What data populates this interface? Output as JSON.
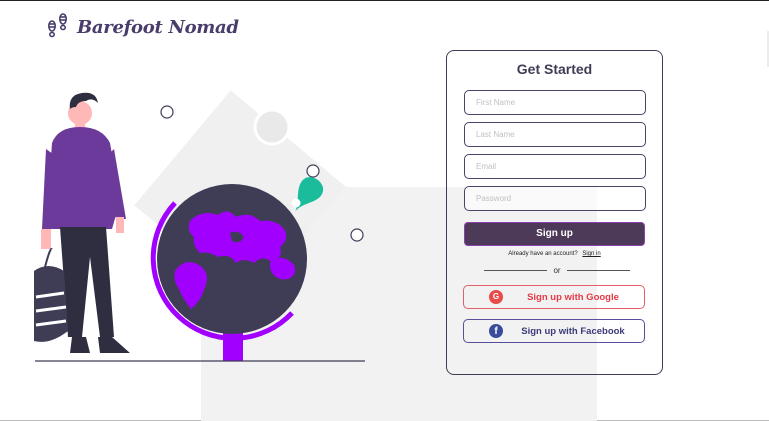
{
  "brand": {
    "name": "Barefoot Nomad"
  },
  "signup_card": {
    "title": "Get Started",
    "fields": {
      "first_name": {
        "placeholder": "First Name",
        "value": ""
      },
      "last_name": {
        "placeholder": "Last Name",
        "value": ""
      },
      "email": {
        "placeholder": "Email",
        "value": ""
      },
      "password": {
        "placeholder": "Password",
        "value": ""
      }
    },
    "signup_label": "Sign up",
    "have_account_text": "Already have an account?",
    "signin_link": "Sign in",
    "or_text": "or",
    "google_label": "Sign up with Google",
    "google_icon_letter": "G",
    "facebook_label": "Sign up with Facebook",
    "facebook_icon_letter": "f"
  },
  "colors": {
    "brand_purple": "#4a3d6b",
    "accent_purple": "#a100ff",
    "marker_green": "#1abc9c",
    "google_red": "#e53945",
    "facebook_blue": "#3b3a7a"
  },
  "icons": [
    "footprints-icon",
    "google-icon",
    "facebook-icon",
    "location-pin-icon"
  ]
}
